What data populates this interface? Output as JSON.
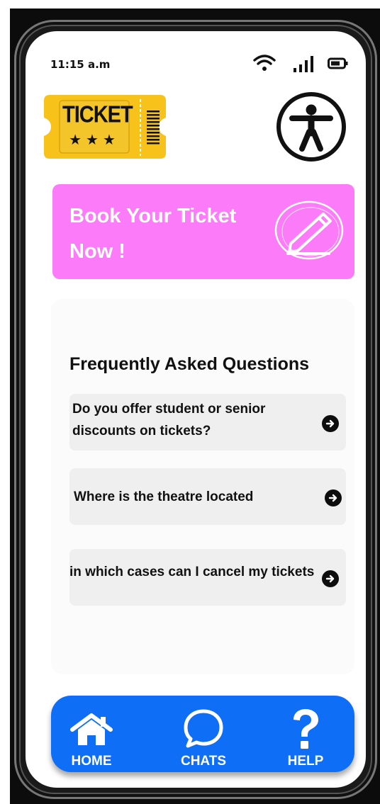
{
  "status_bar": {
    "time": "11:15 a.m",
    "icons": [
      "wifi-icon",
      "signal-icon",
      "battery-icon"
    ]
  },
  "logo": {
    "text": "TICKET",
    "stars": "★★★",
    "color": "#f7c31b"
  },
  "accessibility": {
    "icon": "accessibility-icon"
  },
  "banner": {
    "title": "Book Your Ticket Now !",
    "icon": "pencil-icon",
    "color": "#fb7bf8"
  },
  "faq": {
    "title": "Frequently Asked Questions",
    "items": [
      {
        "question": "Do you offer student or senior discounts on tickets?"
      },
      {
        "question": "Where is the theatre located"
      },
      {
        "question": "in which cases can I cancel my tickets"
      }
    ]
  },
  "nav": {
    "color": "#0f6ef6",
    "items": [
      {
        "label": "HOME",
        "icon": "home-icon"
      },
      {
        "label": "CHATS",
        "icon": "chat-icon"
      },
      {
        "label": "HELP",
        "icon": "help-icon"
      }
    ]
  }
}
